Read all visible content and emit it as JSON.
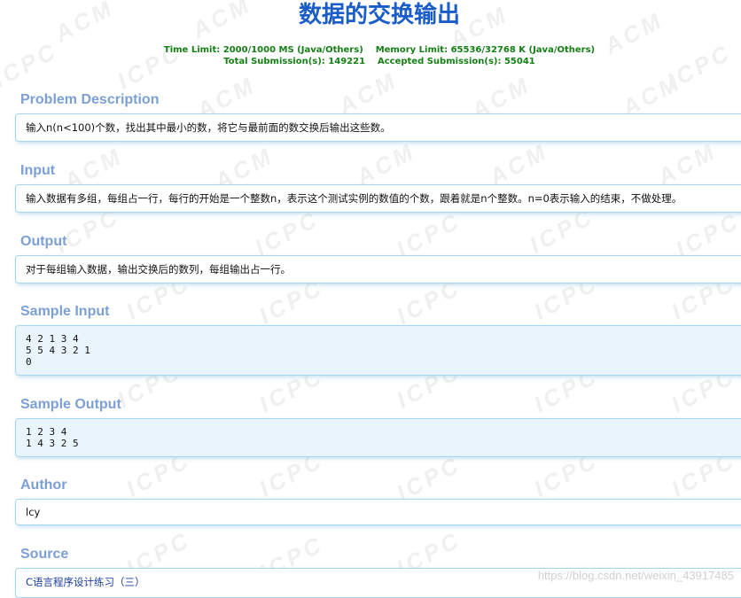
{
  "title": "数据的交换输出",
  "stats": {
    "line1_time": "Time Limit: 2000/1000 MS (Java/Others)",
    "line1_memory": "Memory Limit: 65536/32768 K (Java/Others)",
    "line2_total": "Total Submission(s): 149221",
    "line2_accepted": "Accepted Submission(s): 55041"
  },
  "sections": {
    "description": {
      "heading": "Problem Description",
      "text": "输入n(n<100)个数，找出其中最小的数，将它与最前面的数交换后输出这些数。"
    },
    "input": {
      "heading": "Input",
      "text": "输入数据有多组，每组占一行，每行的开始是一个整数n，表示这个测试实例的数值的个数，跟着就是n个整数。n=0表示输入的结束，不做处理。"
    },
    "output": {
      "heading": "Output",
      "text": "对于每组输入数据，输出交换后的数列，每组输出占一行。"
    },
    "sample_input": {
      "heading": "Sample Input",
      "text": "4 2 1 3 4\n5 5 4 3 2 1\n0"
    },
    "sample_output": {
      "heading": "Sample Output",
      "text": "1 2 3 4\n1 4 3 2 5"
    },
    "author": {
      "heading": "Author",
      "text": "lcy"
    },
    "source": {
      "heading": "Source",
      "text": "C语言程序设计练习（三）"
    }
  },
  "watermark": "https://blog.csdn.net/weixin_43917485",
  "background_watermark": [
    "ACM",
    "ICPC"
  ],
  "colors": {
    "title": "#1a5cc8",
    "stats": "#148014",
    "heading": "#7ca0d4",
    "panel_border": "#a6d7f2",
    "link": "#1a3c9c"
  }
}
